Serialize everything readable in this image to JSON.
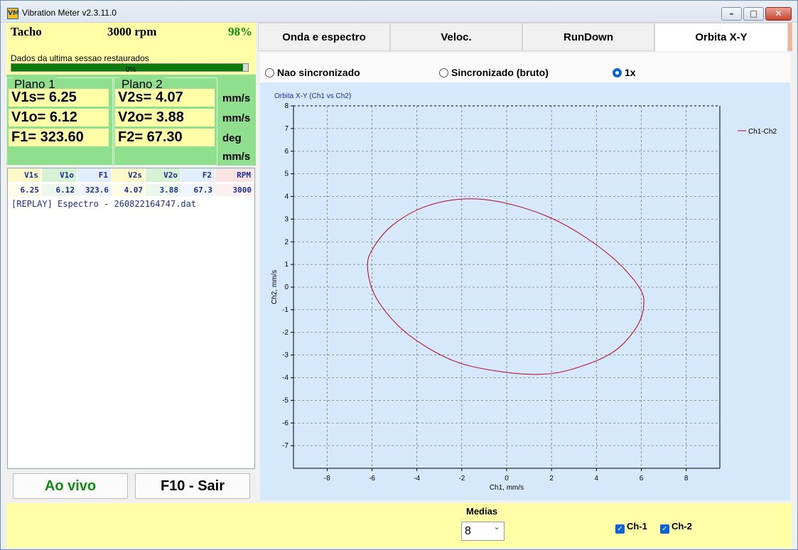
{
  "window": {
    "title": "Vibration Meter v2.3.11.0",
    "app_icon_text": "VM"
  },
  "tacho": {
    "label": "Tacho",
    "rpm": "3000 rpm",
    "percent": "98%",
    "progress": 0.98,
    "message": "Dados da ultima sessao restaurados",
    "secondary_progress": "0%"
  },
  "plane1": {
    "title": "Plano 1",
    "v_s": "V1s= 6.25",
    "v_o": "V1o= 6.12",
    "f": "F1= 323.60"
  },
  "plane2": {
    "title": "Plano 2",
    "v_s": "V2s= 4.07",
    "v_o": "V2o= 3.88",
    "f": "F2= 67.30"
  },
  "units": [
    "mm/s",
    "mm/s",
    "deg",
    "mm/s"
  ],
  "table": {
    "headers": [
      "V1s",
      "V1o",
      "F1",
      "V2s",
      "V2o",
      "F2",
      "RPM"
    ],
    "row": [
      "6.25",
      "6.12",
      "323.6",
      "4.07",
      "3.88",
      "67.3",
      "3000"
    ],
    "replay": "[REPLAY] Espectro - 260822164747.dat"
  },
  "buttons": {
    "live": "Ao vivo",
    "exit": "F10 - Sair"
  },
  "tabs": [
    "Onda e espectro",
    "Veloc.",
    "RunDown",
    "Orbita X-Y"
  ],
  "radios": {
    "nao_sync": "Nao sincronizado",
    "sync": "Sincronizado (bruto)",
    "one_x": "1x"
  },
  "footer": {
    "medias_label": "Medias",
    "medias_value": "8",
    "ch1": "Ch-1",
    "ch2": "Ch-2"
  },
  "chart_data": {
    "type": "scatter",
    "title": "Orbita X-Y (Ch1 vs Ch2)",
    "xlabel": "Ch1, mm/s",
    "ylabel": "Ch2, mm/s",
    "xlim": [
      -9.5,
      9.5
    ],
    "ylim": [
      -8,
      8
    ],
    "xticks": [
      -8,
      -6,
      -4,
      -2,
      0,
      2,
      4,
      6,
      8
    ],
    "yticks": [
      8,
      7,
      6,
      5,
      4,
      3,
      2,
      1,
      0,
      -1,
      -2,
      -3,
      -4,
      -5,
      -6,
      -7
    ],
    "grid": true,
    "legend": "top-right",
    "series": [
      {
        "name": "Ch1-Ch2",
        "color": "#b00020",
        "shape": "ellipse",
        "center": [
          0,
          0
        ],
        "x_extent": [
          -6.2,
          6.1
        ],
        "y_extent": [
          -3.9,
          3.9
        ],
        "points": [
          [
            -6.2,
            0.9
          ],
          [
            -5.9,
            1.8
          ],
          [
            -5.0,
            2.8
          ],
          [
            -3.5,
            3.6
          ],
          [
            -1.6,
            3.9
          ],
          [
            0.4,
            3.6
          ],
          [
            2.5,
            2.8
          ],
          [
            4.6,
            1.4
          ],
          [
            5.9,
            0.0
          ],
          [
            6.1,
            -0.9
          ],
          [
            5.7,
            -1.9
          ],
          [
            4.7,
            -2.9
          ],
          [
            3.0,
            -3.6
          ],
          [
            1.5,
            -3.85
          ],
          [
            -0.5,
            -3.7
          ],
          [
            -2.5,
            -3.2
          ],
          [
            -4.5,
            -2.0
          ],
          [
            -5.8,
            -0.5
          ]
        ]
      }
    ]
  }
}
